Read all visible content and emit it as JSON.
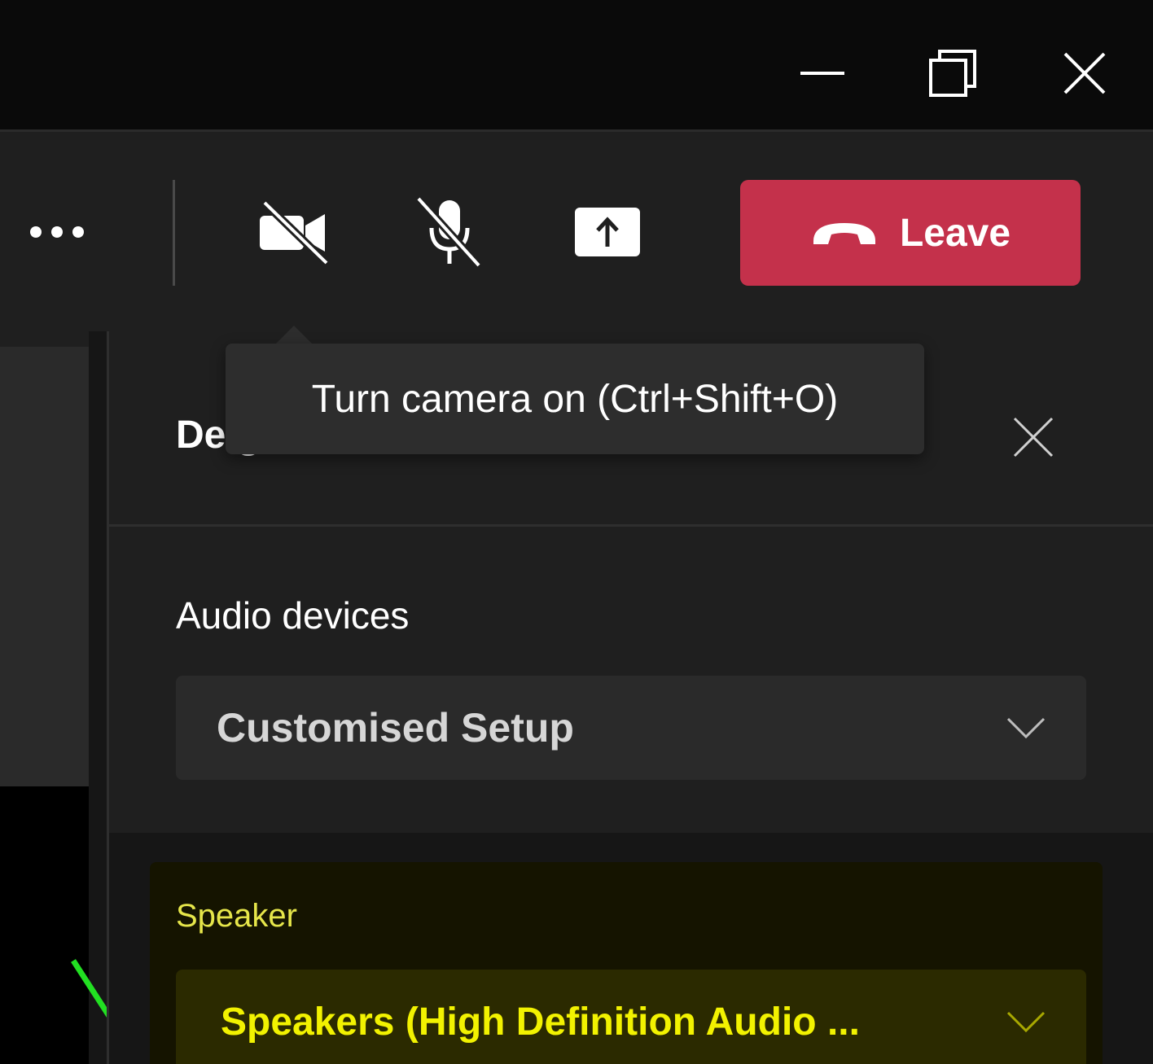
{
  "window_controls": {
    "minimize_icon": "minimize-icon",
    "restore_icon": "restore-icon",
    "close_icon": "close-icon"
  },
  "toolbar": {
    "more_icon": "more-options-icon",
    "camera_icon": "camera-off-icon",
    "mic_icon": "mic-off-icon",
    "share_icon": "share-screen-icon",
    "leave_label": "Leave",
    "leave_icon": "phone-hangup-icon",
    "leave_color": "#c4314b"
  },
  "tooltip": {
    "text": "Turn camera on (Ctrl+Shift+O)"
  },
  "panel": {
    "title": "De          gs",
    "close_icon": "close-icon",
    "audio_devices_label": "Audio devices",
    "audio_devices_value": "Customised Setup",
    "speaker_label": "Speaker",
    "speaker_value": "Speakers (High Definition Audio ...",
    "highlight_color": "#f2f200"
  }
}
